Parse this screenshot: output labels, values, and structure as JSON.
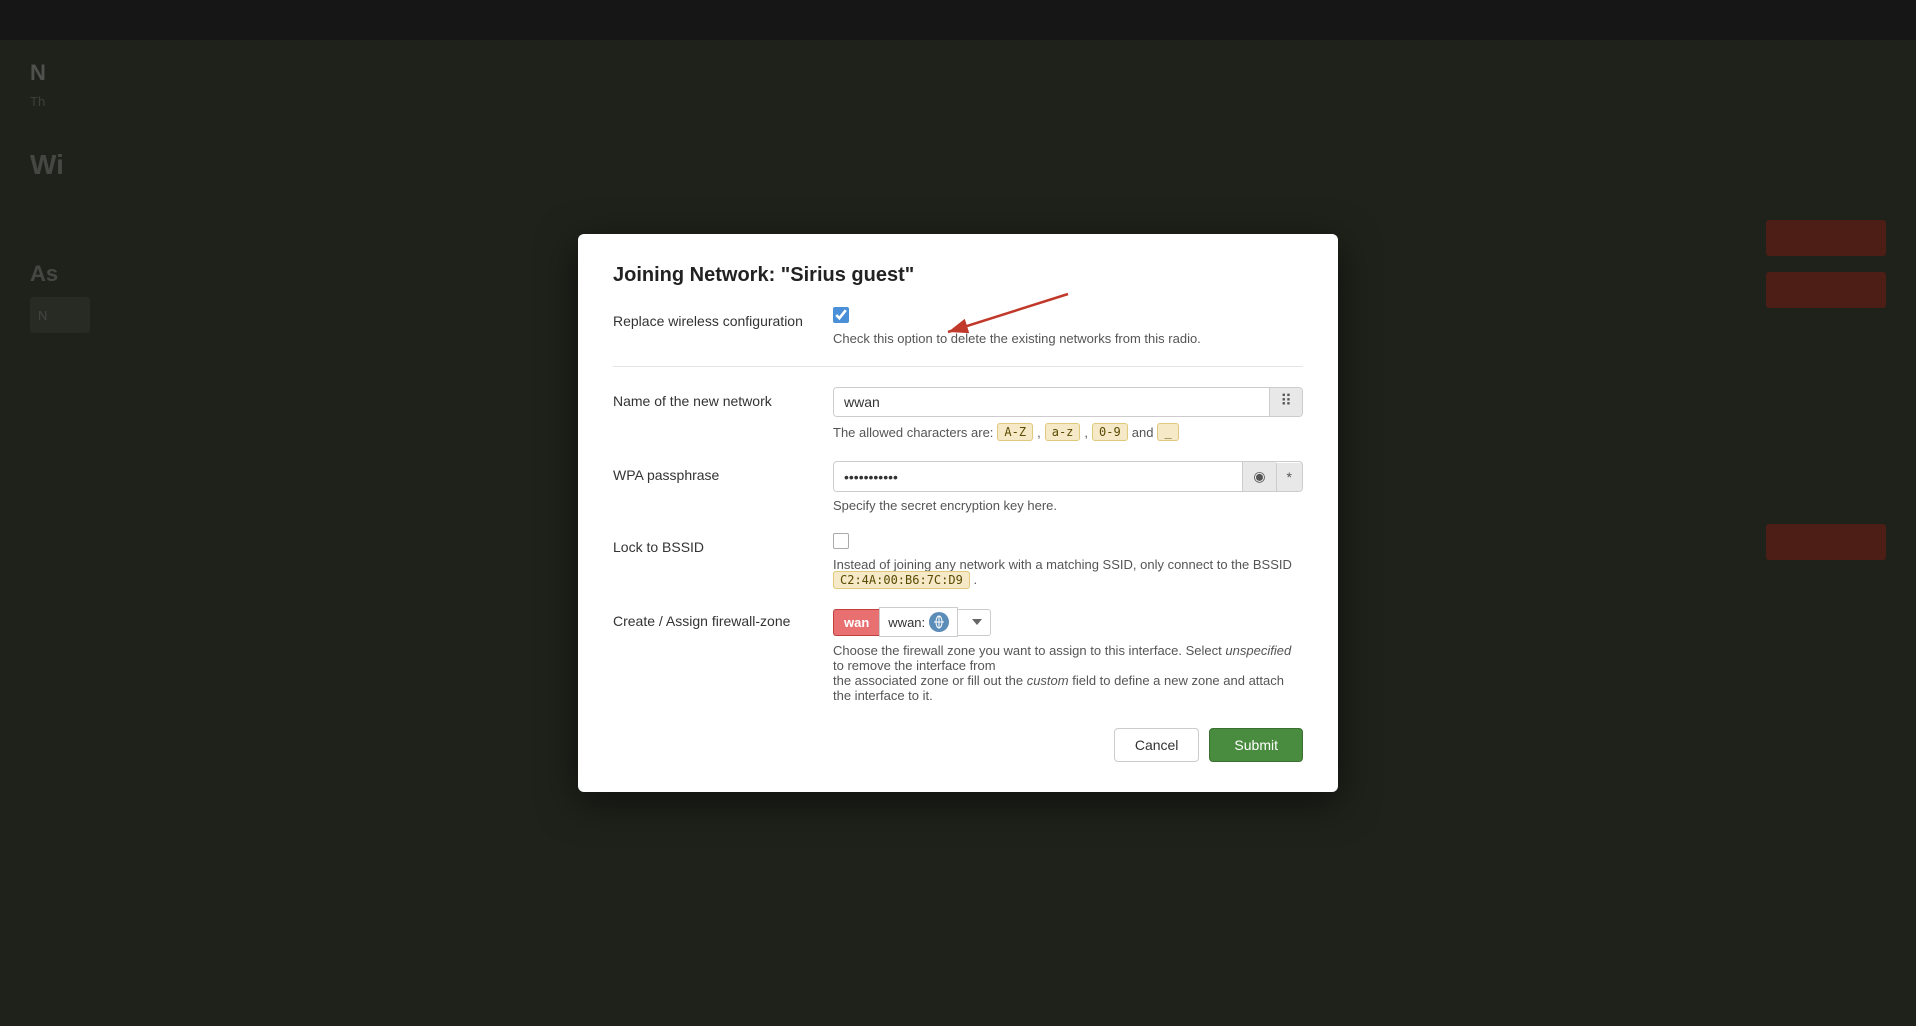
{
  "background": {
    "topbar_color": "#2c2c2c",
    "page_bg": "#3d4535"
  },
  "modal": {
    "title": "Joining Network: \"Sirius guest\"",
    "replace_wireless_label": "Replace wireless configuration",
    "replace_wireless_checked": true,
    "replace_wireless_help": "Check this option to delete the existing networks from this radio.",
    "network_name_label": "Name of the new network",
    "network_name_value": "wwan",
    "network_name_placeholder": "",
    "allowed_chars_prefix": "The allowed characters are:",
    "allowed_chars": [
      "A-Z",
      "a-z",
      "0-9",
      "_"
    ],
    "wpa_label": "WPA passphrase",
    "wpa_value": "••••••••••",
    "wpa_help": "Specify the secret encryption key here.",
    "lock_bssid_label": "Lock to BSSID",
    "lock_bssid_checked": false,
    "lock_bssid_help_prefix": "Instead of joining any network with a matching SSID, only connect to the BSSID",
    "bssid_value": "C2:4A:00:B6:7C:D9",
    "lock_bssid_help_suffix": ".",
    "firewall_label": "Create / Assign firewall-zone",
    "firewall_wan_badge": "wan",
    "firewall_wwan_text": "wwan:",
    "firewall_help_line1": "Choose the firewall zone you want to assign to this interface. Select",
    "firewall_help_italic": "unspecified",
    "firewall_help_line2": "to remove the interface from",
    "firewall_help_line3": "the associated zone or fill out the",
    "firewall_help_italic2": "custom",
    "firewall_help_line4": "field to define a new zone and attach the interface to it.",
    "cancel_label": "Cancel",
    "submit_label": "Submit"
  }
}
